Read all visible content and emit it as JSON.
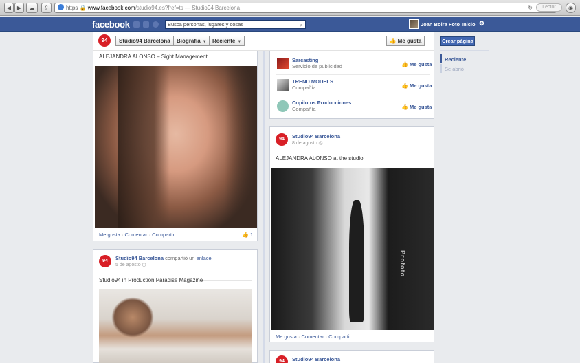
{
  "browser": {
    "back": "◀",
    "forward": "▶",
    "url_scheme": "https",
    "url_domain": "www.facebook.com",
    "url_path": "/studio94.es?fref=ts — Studio94 Barcelona",
    "reload": "↻",
    "reader_label": "Lector"
  },
  "fb": {
    "logo": "facebook",
    "search_placeholder": "Busca personas, lugares y cosas",
    "user_name": "Joan Boira Foto",
    "home_label": "Inicio"
  },
  "page_header": {
    "page_name": "Studio94 Barcelona",
    "tab_timeline": "Biografía",
    "tab_recent": "Reciente",
    "like_button": "Me gusta",
    "logo_text": "94"
  },
  "left_post_1": {
    "title": "ALEJANDRA ALONSO – Sight Management",
    "like": "Me gusta",
    "comment": "Comentar",
    "share": "Compartir",
    "like_count": "1"
  },
  "left_post_2": {
    "author": "Studio94 Barcelona",
    "shared_text": "compartió un",
    "shared_link": "enlace.",
    "date": "5 de agosto",
    "title": "Studio94 in Production Paradise Magazine"
  },
  "likes_box": {
    "items": [
      {
        "name": "Sarcasting",
        "category": "Servicio de publicidad",
        "like": "Me gusta"
      },
      {
        "name": "TREND MODELS",
        "category": "Compañía",
        "like": "Me gusta"
      },
      {
        "name": "Copilotos Producciones",
        "category": "Compañía",
        "like": "Me gusta"
      }
    ]
  },
  "right_post_1": {
    "author": "Studio94 Barcelona",
    "date": "8 de agosto",
    "title": "ALEJANDRA ALONSO at the studio",
    "like": "Me gusta",
    "comment": "Comentar",
    "share": "Compartir",
    "brand_text": "Profoto"
  },
  "right_post_2": {
    "author": "Studio94 Barcelona"
  },
  "sidebar": {
    "create_page": "Crear página",
    "recent": "Reciente",
    "opened": "Se abrió"
  },
  "colors": {
    "fb_blue": "#3b5998",
    "brand_red": "#d81f26"
  }
}
